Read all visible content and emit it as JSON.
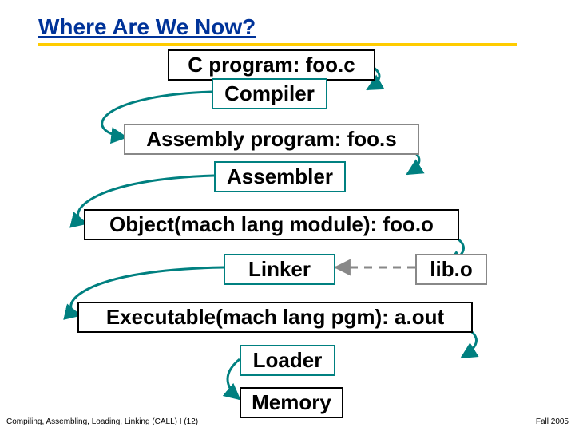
{
  "title": "Where Are We Now?",
  "stages": {
    "c_program": "C program: foo.c",
    "compiler": "Compiler",
    "assembly": "Assembly program: foo.s",
    "assembler": "Assembler",
    "object": "Object(mach lang module): foo.o",
    "linker": "Linker",
    "lib": "lib.o",
    "executable": "Executable(mach lang pgm): a.out",
    "loader": "Loader",
    "memory": "Memory"
  },
  "footer": {
    "left": "Compiling, Assembling, Loading, Linking (CALL) I (12)",
    "right": "Fall 2005"
  },
  "colors": {
    "teal": "#008080",
    "gray": "#888888",
    "title_blue": "#003399",
    "rule_yellow": "#ffcc00"
  }
}
